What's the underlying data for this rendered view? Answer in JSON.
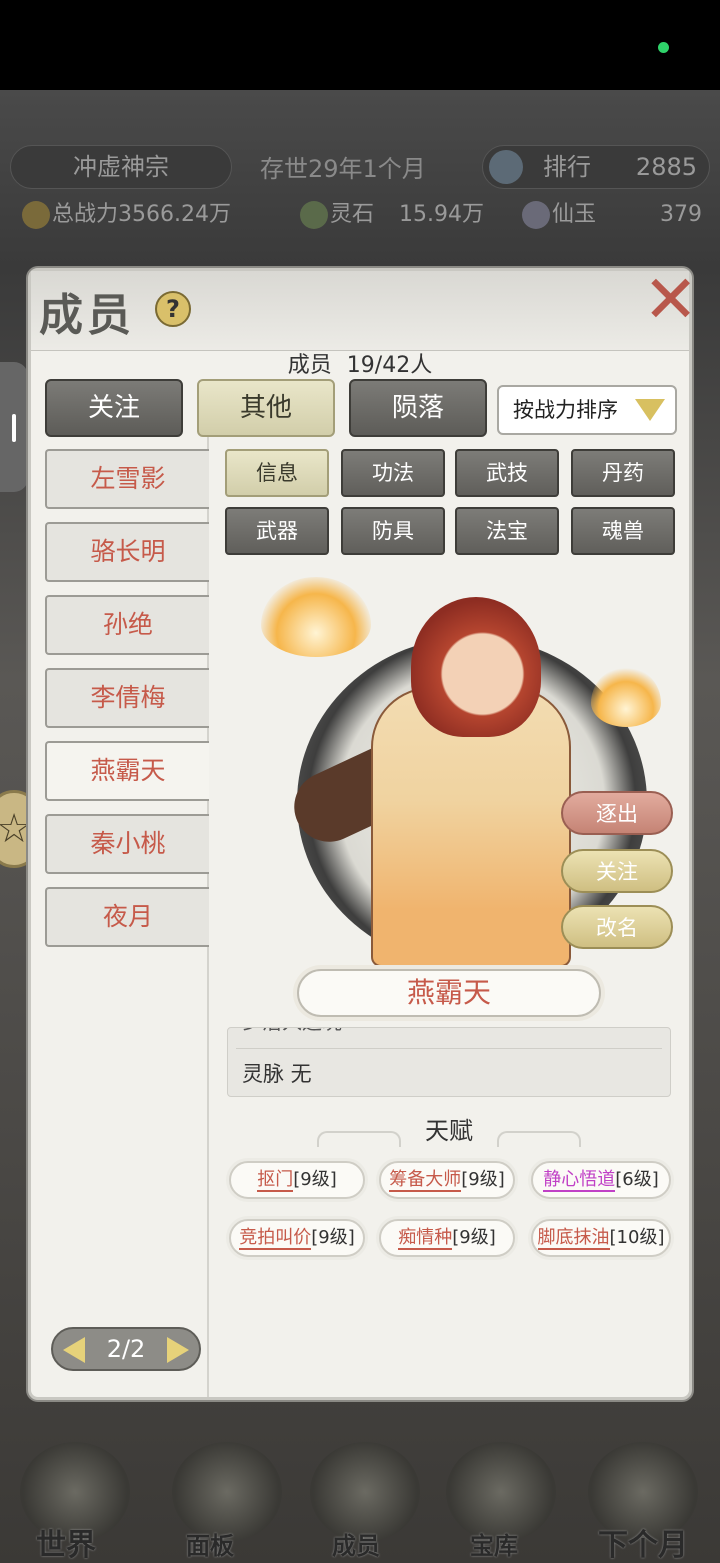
{
  "header": {
    "sect_name": "冲虚神宗",
    "age": "存世29年1个月",
    "rank_label": "排行",
    "rank_value": "2885"
  },
  "resources": {
    "power_label": "总战力",
    "power_value": "3566.24万",
    "spirit_stone_label": "灵石",
    "spirit_stone_value": "15.94万",
    "jade_label": "仙玉",
    "jade_value": "379"
  },
  "panel": {
    "title": "成员",
    "help_glyph": "?",
    "close_glyph": "✕",
    "member_count_label": "成员",
    "member_count_value": "19/42人"
  },
  "filters": {
    "follow": "关注",
    "other": "其他",
    "fallen": "陨落",
    "sort": "按战力排序"
  },
  "members": [
    {
      "name": "左雪影"
    },
    {
      "name": "骆长明"
    },
    {
      "name": "孙绝"
    },
    {
      "name": "李倩梅"
    },
    {
      "name": "燕霸天"
    },
    {
      "name": "秦小桃"
    },
    {
      "name": "夜月"
    }
  ],
  "categories": [
    {
      "label": "信息"
    },
    {
      "label": "功法"
    },
    {
      "label": "武技"
    },
    {
      "label": "丹药"
    },
    {
      "label": "武器"
    },
    {
      "label": "防具"
    },
    {
      "label": "法宝"
    },
    {
      "label": "魂兽"
    }
  ],
  "detail": {
    "name": "燕霸天",
    "actions": {
      "expel": "逐出",
      "follow": "关注",
      "rename": "改名"
    },
    "info_cut": "乡治入运况",
    "info_row": "灵脉 无",
    "talent_title": "天赋",
    "talents": [
      {
        "name": "抠门",
        "level": "[9级]"
      },
      {
        "name": "筹备大师",
        "level": "[9级]"
      },
      {
        "name": "静心悟道",
        "level": "[6级]"
      },
      {
        "name": "竞拍叫价",
        "level": "[9级]"
      },
      {
        "name": "痴情种",
        "level": "[9级]"
      },
      {
        "name": "脚底抹油",
        "level": "[10级]"
      }
    ]
  },
  "pager": {
    "label": "2/2"
  },
  "bottom_nav": {
    "world": "世界",
    "panel": "面板",
    "members": "成员",
    "treasury": "宝库",
    "next_month": "下个月"
  },
  "colors": {
    "member_name_red": "#c65a4a",
    "talent_purple": "#c040c6",
    "active_button": "#e9e6c9"
  }
}
